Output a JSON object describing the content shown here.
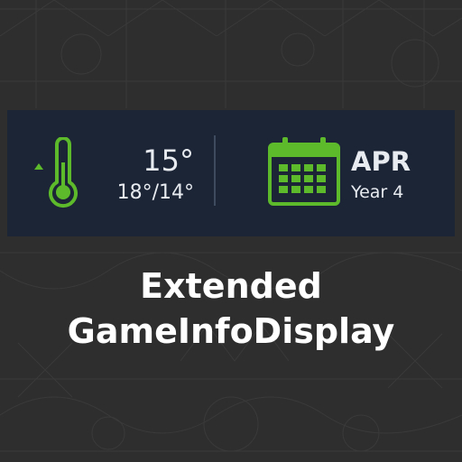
{
  "hud": {
    "temperature": {
      "current": "15°",
      "range": "18°/14°",
      "trend_icon": "arrow-up-icon"
    },
    "date": {
      "month": "APR",
      "year": "Year 4",
      "icon": "calendar-icon"
    }
  },
  "title": {
    "line1": "Extended",
    "line2": "GameInfoDisplay"
  },
  "colors": {
    "background": "#2f2f2f",
    "panel": "#1c2536",
    "accent_green": "#5dbb2b",
    "text": "#e8ecf1"
  }
}
